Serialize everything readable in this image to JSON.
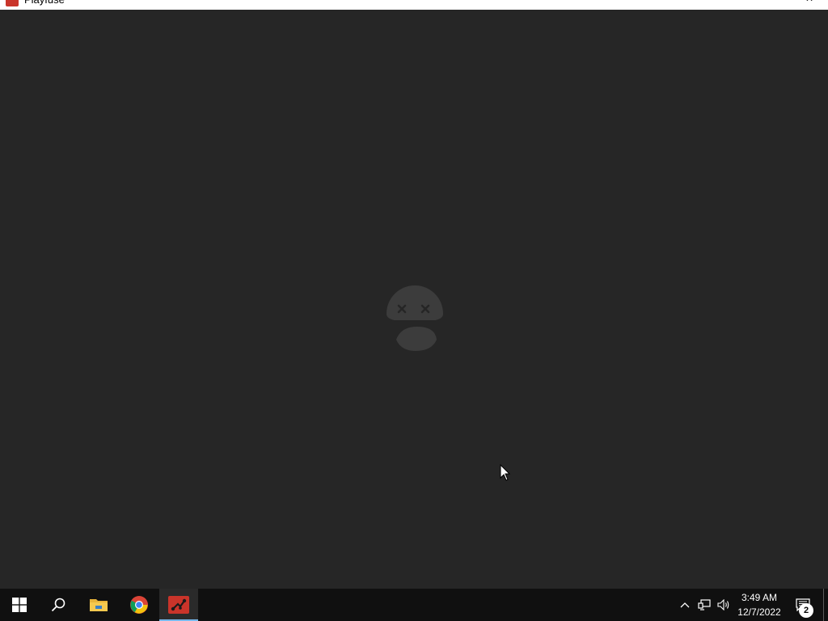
{
  "window": {
    "title": "Playfuse",
    "minimize_glyph": "—",
    "close_glyph": "✕"
  },
  "content": {
    "state_icon": "sad-face-error-icon"
  },
  "taskbar": {
    "apps": [
      {
        "name": "start",
        "icon": "windows-logo-icon"
      },
      {
        "name": "search",
        "icon": "search-icon"
      },
      {
        "name": "file-explorer",
        "icon": "folder-icon"
      },
      {
        "name": "chrome",
        "icon": "chrome-icon"
      },
      {
        "name": "playfuse",
        "icon": "playfuse-icon",
        "active": true
      }
    ],
    "clock": {
      "time": "3:49 AM",
      "date": "12/7/2022"
    },
    "notifications": {
      "count": "2"
    }
  },
  "colors": {
    "background": "#262626",
    "taskbar": "#101010",
    "active_underline": "#76b9ed",
    "app_red": "#c9342a",
    "face_gray": "#3c3c3c"
  }
}
